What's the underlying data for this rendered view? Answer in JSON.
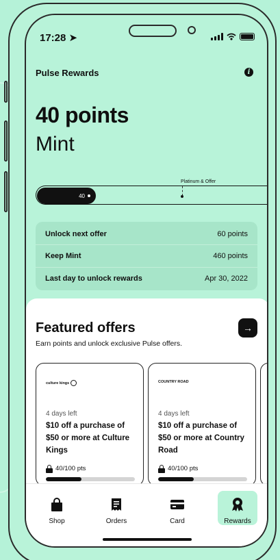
{
  "status_bar": {
    "time": "17:28"
  },
  "header": {
    "title": "Pulse Rewards",
    "info_icon": "info-icon"
  },
  "summary": {
    "points": "40 points",
    "tier": "Mint"
  },
  "progress": {
    "current_label": "40",
    "milestone_label": "Platinum & Offer"
  },
  "info_rows": [
    {
      "label": "Unlock next offer",
      "value": "60 points"
    },
    {
      "label": "Keep Mint",
      "value": "460 points"
    },
    {
      "label": "Last day to unlock rewards",
      "value": "Apr 30, 2022"
    }
  ],
  "featured": {
    "title": "Featured offers",
    "subtitle": "Earn points and unlock exclusive Pulse offers.",
    "arrow_icon": "arrow-right-icon"
  },
  "offers": [
    {
      "brand": "culture kings",
      "days_left": "4 days left",
      "title": "$10 off a purchase of $50 or more at Culture Kings",
      "points": "40/100 pts",
      "progress": 0.4
    },
    {
      "brand": "COUNTRY ROAD",
      "days_left": "4 days left",
      "title": "$10 off a purchase of $50 or more at Country Road",
      "points": "40/100 pts",
      "progress": 0.4
    }
  ],
  "tabs": [
    {
      "label": "Shop",
      "icon": "shopping-bag-icon",
      "active": false
    },
    {
      "label": "Orders",
      "icon": "receipt-icon",
      "active": false
    },
    {
      "label": "Card",
      "icon": "credit-card-icon",
      "active": false
    },
    {
      "label": "Rewards",
      "icon": "award-icon",
      "active": true
    }
  ],
  "colors": {
    "background": "#b5f2d8",
    "accent": "#111111",
    "panel": "#a7e5c9"
  }
}
